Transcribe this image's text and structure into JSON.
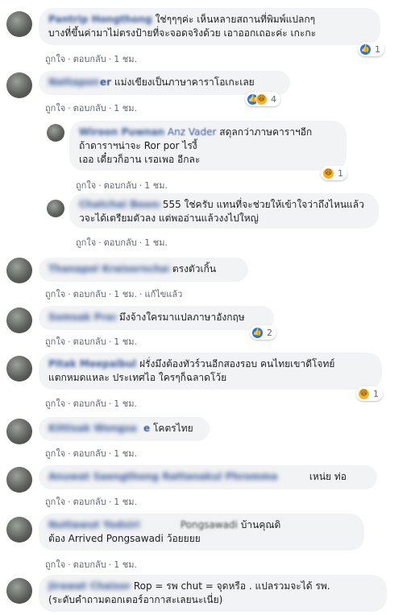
{
  "actions": {
    "like": "ถูกใจ",
    "reply": "ตอบกลับ",
    "dot": "·",
    "edited": "แก้ไขแล้ว"
  },
  "comments": [
    {
      "name": "Pantrip Hongthong",
      "lines": [
        "ใช่ๆๆๆค่ะ เห็นหลายสถานที่พิมพ์แปลกๆ",
        "บางที่ขึ้นค่ามาไม่ตรงป้ายที่จะจอดจริงด้วย เอาออกเถอะค่ะ เกะกะ"
      ],
      "time": "1 ชม.",
      "reaction_count": "1",
      "reactions": [
        "like-icon"
      ]
    },
    {
      "name": "Nattapong Suwannarat",
      "visible_name_tail": "er",
      "lines": [
        "แม่งเขียงเป็นภาษาคาราโอเกะเลย"
      ],
      "time": "1 ชม.",
      "reaction_count": "4",
      "reactions": [
        "like-icon",
        "haha-icon"
      ]
    },
    {
      "name": "Wiroon Puwnan",
      "visible_name_tail": "Anz Vader",
      "lines": [
        "สดุลกว่าภาษคาราฯอีก",
        "ถ้าดาราฯน่าจะ Ror por ไรงี้",
        "เออ เดี๋ยวก็อาน เรอเพอ อีกละ"
      ],
      "time": "1 ชม.",
      "reaction_count": "1",
      "reactions": [
        "haha-icon"
      ]
    },
    {
      "name": "Chatchai Boonmee",
      "lines": [
        "555 ใช่ครับ แทนที่จะช่วยให้เข้าใจว่าถึงไหนแล้ว",
        "วจะได้เตรียมตัวลง แต่พออ่านแล้วงงไปใหญ่"
      ],
      "time": "1 ชม."
    },
    {
      "name": "Thanapol Kraisornchai",
      "lines": [
        "ตรงตัวเกิ้น"
      ],
      "time": "1 ชม.",
      "edited": true
    },
    {
      "name": "Somsak Prasert",
      "lines": [
        "มึงจ้างใครมาแปลภาษาอังกฤษ"
      ],
      "time": "1 ชม.",
      "reaction_count": "2",
      "reactions": [
        "like-icon"
      ]
    },
    {
      "name": "Pitak Meepaibul",
      "lines": [
        "ฝรั่งมึงต้องทัวร์วนอีกสองรอบ คนไทยเขาดีโจทย์",
        "แตกหมดแหละ ประเทศไอ ใครๆก็ฉลาดโว้ย"
      ],
      "time": "1 ชม.",
      "reaction_count": "1",
      "reactions": [
        "haha-icon"
      ]
    },
    {
      "name": "Kittisak Wongsa",
      "visible_name_tail": "e",
      "lines": [
        "โคตรไทย"
      ],
      "time": "1 ชม."
    },
    {
      "name": "Anuwat Saengthong Rattanakul Phromma",
      "lines": [
        "เหน่ย ท่อ"
      ],
      "time": "1 ชม."
    },
    {
      "name": "Nuttawut Yodsiri",
      "visible_name_tail": "Pongsawadi",
      "lines": [
        "บ้านคุณดิ",
        "ต้อง Arrived Pongsawadi ว้อยยยย"
      ],
      "time": "1 ชม."
    },
    {
      "name": "Jirawat Chaisong",
      "lines": [
        "Rop = รพ chut = จุดหรือ . แปลรวมจะได้ รพ.",
        "(ระดับคำถามดอกเตอร์อากาสะเลยนะเนี่ย)"
      ],
      "time": ""
    }
  ]
}
